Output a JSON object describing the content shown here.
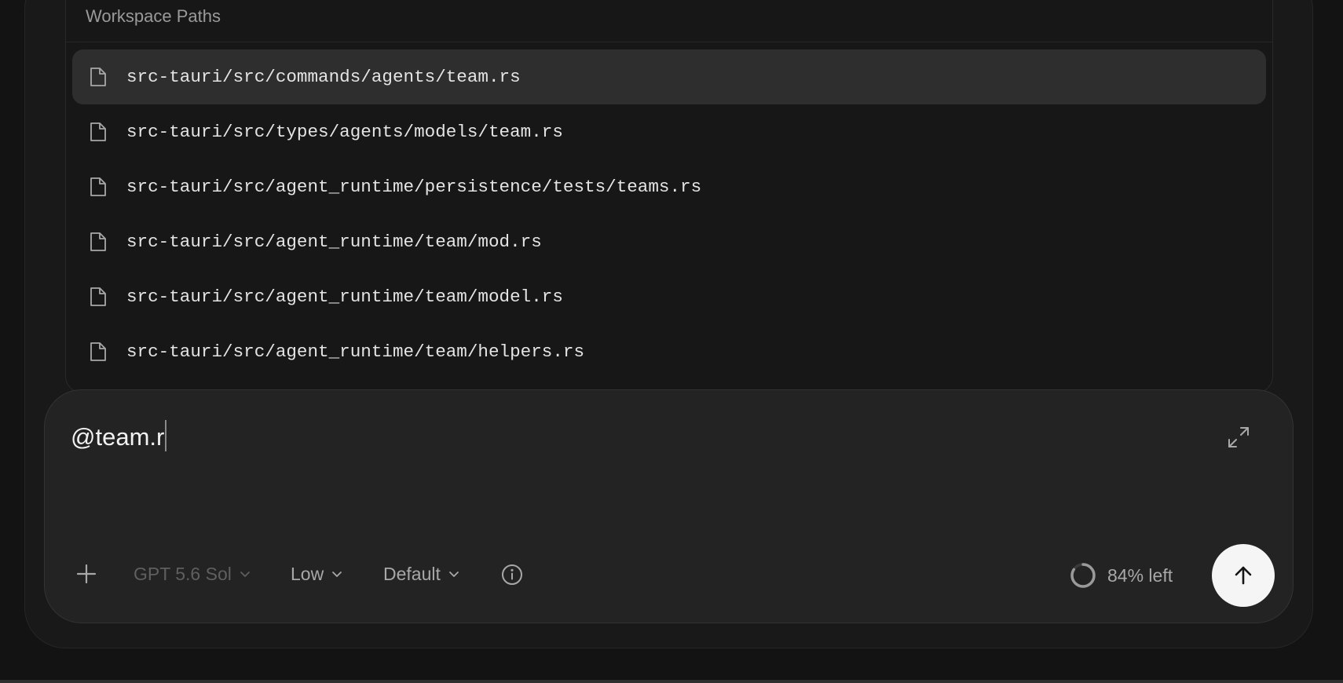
{
  "popup": {
    "header": "Workspace Paths",
    "items": [
      {
        "path": "src-tauri/src/commands/agents/team.rs",
        "selected": true
      },
      {
        "path": "src-tauri/src/types/agents/models/team.rs",
        "selected": false
      },
      {
        "path": "src-tauri/src/agent_runtime/persistence/tests/teams.rs",
        "selected": false
      },
      {
        "path": "src-tauri/src/agent_runtime/team/mod.rs",
        "selected": false
      },
      {
        "path": "src-tauri/src/agent_runtime/team/model.rs",
        "selected": false
      },
      {
        "path": "src-tauri/src/agent_runtime/team/helpers.rs",
        "selected": false
      }
    ],
    "item_icon": "file-icon"
  },
  "composer": {
    "input_value": "@team.r",
    "model_label": "GPT 5.6 Sol",
    "effort_label": "Low",
    "mode_label": "Default",
    "context_label": "84% left",
    "context_remaining_fraction": 0.84,
    "icons": {
      "expand": "expand-icon",
      "add": "plus-icon",
      "info": "info-icon",
      "send": "arrow-up-icon",
      "dropdown": "chevron-down-icon"
    }
  },
  "colors": {
    "background": "#131313",
    "panel": "#191919",
    "popup": "#171717",
    "selected_row": "#2e2e2e",
    "composer": "#232323",
    "send_button": "#f5f5f5"
  }
}
